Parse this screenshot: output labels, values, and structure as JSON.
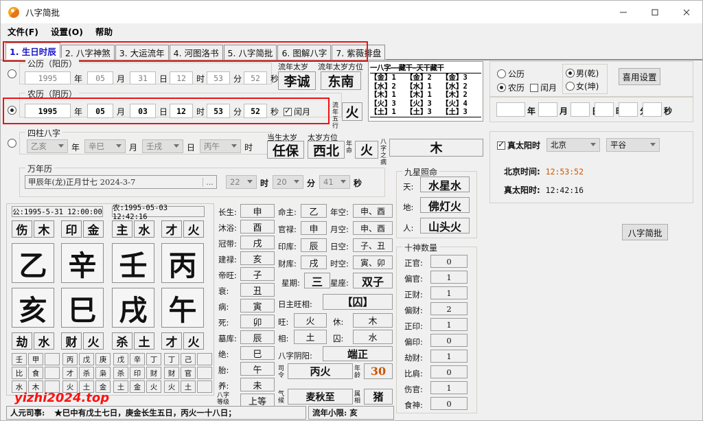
{
  "window": {
    "title": "八字简批",
    "minimize": "—",
    "maximize": "□",
    "close": "✕"
  },
  "menu": [
    {
      "label": "文件(F)"
    },
    {
      "label": "设置(O)"
    },
    {
      "label": "帮助"
    }
  ],
  "tabs": [
    {
      "label": "1. 生日时辰",
      "active": true
    },
    {
      "label": "2. 八字神煞",
      "active": false
    },
    {
      "label": "3. 大运流年",
      "active": false
    },
    {
      "label": "4. 河图洛书",
      "active": false
    },
    {
      "label": "5. 八字简批",
      "active": false
    },
    {
      "label": "6. 图解八字",
      "active": false
    },
    {
      "label": "7. 紫薇排盘",
      "active": false
    }
  ],
  "solar": {
    "caption": "公历（阳历）",
    "selected": false,
    "year": "1995",
    "month": "05",
    "day": "31",
    "hour": "12",
    "minute": "53",
    "second": "52",
    "unit_year": "年",
    "unit_month": "月",
    "unit_day": "日",
    "unit_hour": "时",
    "unit_minute": "分",
    "unit_second": "秒"
  },
  "lunar": {
    "caption": "农历（阴历）",
    "selected": true,
    "year": "1995",
    "month": "05",
    "day": "03",
    "hour": "12",
    "minute": "53",
    "second": "52",
    "unit_year": "年",
    "unit_month": "月",
    "unit_day": "日",
    "unit_hour": "时",
    "unit_minute": "分",
    "unit_second": "秒",
    "leap_label": "闰月",
    "leap_checked": true
  },
  "taisui": {
    "year_label": "流年太岁",
    "year_value": "李诚",
    "dir_label": "流年太岁方位",
    "dir_value": "东南",
    "wuxing_label": "流年五行",
    "wuxing_value": "火"
  },
  "pillars": {
    "caption": "四柱八字",
    "selected": false,
    "year": "乙亥",
    "month": "辛巳",
    "day": "壬戌",
    "hour": "丙午",
    "unit_year": "年",
    "unit_month": "月",
    "unit_day": "日",
    "unit_hour": "时"
  },
  "birth_taisui": {
    "label": "当生太岁",
    "value": "任保",
    "dir_label": "太岁方位",
    "dir_value": "西北",
    "nianming_label": "年命",
    "nianming_value": "火",
    "bingh_label": "八字之病",
    "bingh_value": "木"
  },
  "wannianli": {
    "caption": "万年历",
    "text": "甲辰年(龙)正月廿七  2024-3-7",
    "browse": "...",
    "hour": "22",
    "minute": "20",
    "second": "41",
    "unit_hour": "时",
    "unit_minute": "分",
    "unit_second": "秒"
  },
  "elements_table": {
    "header": "一八字——藏干—天干藏干",
    "rows": [
      {
        "name": "【金】",
        "bazi": "1",
        "canggan": "2",
        "tiangan": "3"
      },
      {
        "name": "【水】",
        "bazi": "2",
        "canggan": "1",
        "tiangan": "2"
      },
      {
        "name": "【木】",
        "bazi": "1",
        "canggan": "1",
        "tiangan": "2"
      },
      {
        "name": "【火】",
        "bazi": "3",
        "canggan": "3",
        "tiangan": "4"
      },
      {
        "name": "【土】",
        "bazi": "1",
        "canggan": "3",
        "tiangan": "3"
      }
    ]
  },
  "calendar_opts": {
    "solar_label": "公历",
    "solar_selected": false,
    "lunar_label": "农历",
    "lunar_selected": true,
    "leap_label": "闰月",
    "leap_checked": false,
    "male_label": "男(乾)",
    "male_selected": true,
    "female_label": "女(坤)",
    "female_selected": false,
    "settings_button": "喜用设置"
  },
  "blank_date": {
    "year": "",
    "month": "",
    "day": "",
    "hour": "",
    "minute": "",
    "second": "",
    "unit_year": "年",
    "unit_month": "月",
    "unit_day": "日",
    "unit_hour": "时",
    "unit_minute": "分",
    "unit_second": "秒"
  },
  "truesolar": {
    "check_label": "真太阳时",
    "checked": true,
    "province": "北京",
    "city": "平谷",
    "beijing_label": "北京时间:",
    "beijing_value": "12:53:52",
    "true_label": "真太阳时:",
    "true_value": "12:42:16",
    "analyze_button": "八字简批"
  },
  "chart": {
    "solar_header": "公:1995-5-31 12:00:00",
    "lunar_header": "农:1995-05-03 12:42:16",
    "top_gods": [
      {
        "god": "伤",
        "elem": "木"
      },
      {
        "god": "印",
        "elem": "金"
      },
      {
        "god": "主",
        "elem": "水"
      },
      {
        "god": "才",
        "elem": "火"
      }
    ],
    "stems": [
      "乙",
      "辛",
      "壬",
      "丙"
    ],
    "branches": [
      "亥",
      "巳",
      "戌",
      "午"
    ],
    "bottom_gods": [
      {
        "god": "劫",
        "elem": "水"
      },
      {
        "god": "财",
        "elem": "火"
      },
      {
        "god": "杀",
        "elem": "土"
      },
      {
        "god": "才",
        "elem": "火"
      }
    ],
    "hidden": [
      {
        "stems": [
          "壬",
          "甲",
          ""
        ],
        "gods": [
          "比",
          "食",
          ""
        ],
        "elems": [
          "水",
          "木",
          ""
        ]
      },
      {
        "stems": [
          "丙",
          "戊",
          "庚"
        ],
        "gods": [
          "才",
          "杀",
          "枭"
        ],
        "elems": [
          "火",
          "土",
          "金"
        ]
      },
      {
        "stems": [
          "戊",
          "辛",
          "丁"
        ],
        "gods": [
          "杀",
          "印",
          "财"
        ],
        "elems": [
          "土",
          "金",
          "火"
        ]
      },
      {
        "stems": [
          "丁",
          "己",
          ""
        ],
        "gods": [
          "财",
          "官",
          ""
        ],
        "elems": [
          "火",
          "土",
          ""
        ]
      }
    ]
  },
  "watermark": "yizhi2024.top",
  "stages": [
    {
      "label": "长生:",
      "value": "申"
    },
    {
      "label": "沐浴:",
      "value": "酉"
    },
    {
      "label": "冠带:",
      "value": "戌"
    },
    {
      "label": "建禄:",
      "value": "亥"
    },
    {
      "label": "帝旺:",
      "value": "子"
    },
    {
      "label": "衰:",
      "value": "丑"
    },
    {
      "label": "病:",
      "value": "寅"
    },
    {
      "label": "死:",
      "value": "卯"
    },
    {
      "label": "墓库:",
      "value": "辰"
    },
    {
      "label": "绝:",
      "value": "巳"
    },
    {
      "label": "胎:",
      "value": "午"
    },
    {
      "label": "养:",
      "value": "未"
    },
    {
      "label": "八字等级",
      "value": "上等"
    }
  ],
  "info_left": [
    {
      "label": "命主:",
      "value": "乙"
    },
    {
      "label": "官禄:",
      "value": "申"
    },
    {
      "label": "印库:",
      "value": "辰"
    },
    {
      "label": "财库:",
      "value": "戌"
    },
    {
      "label": "星期:",
      "value": "三"
    }
  ],
  "info_right": [
    {
      "label": "年空:",
      "value": "申、酉"
    },
    {
      "label": "月空:",
      "value": "申、酉"
    },
    {
      "label": "日空:",
      "value": "子、丑"
    },
    {
      "label": "时空:",
      "value": "寅、卯"
    },
    {
      "label": "星座:",
      "value": "双子"
    }
  ],
  "rizhu": {
    "label": "日主旺相:",
    "value": "【囚】",
    "wang_label": "旺:",
    "wang_value": "火",
    "xiu_label": "休:",
    "xiu_value": "木",
    "xiang_label": "相:",
    "xiang_value": "土",
    "qiu_label": "囚:",
    "qiu_value": "水",
    "yinyang_label": "八字阴阳:",
    "yinyang_value": "端正",
    "siling_label": "司令",
    "siling_value": "丙火",
    "age_label": "年龄",
    "age_value": "30",
    "qihou_label": "气候",
    "qihou_value": "麦秋至",
    "zodiac_label": "属相",
    "zodiac_value": "猪"
  },
  "jiuxing": {
    "caption": "九星照命",
    "rows": [
      {
        "label": "天:",
        "value": "水星水"
      },
      {
        "label": "地:",
        "value": "佛灯火"
      },
      {
        "label": "人:",
        "value": "山头火"
      }
    ]
  },
  "shishen": {
    "caption": "十神数量",
    "rows": [
      {
        "label": "正官:",
        "value": "0"
      },
      {
        "label": "偏官:",
        "value": "1"
      },
      {
        "label": "正财:",
        "value": "1"
      },
      {
        "label": "偏财:",
        "value": "2"
      },
      {
        "label": "正印:",
        "value": "1"
      },
      {
        "label": "偏印:",
        "value": "0"
      },
      {
        "label": "劫财:",
        "value": "1"
      },
      {
        "label": "比肩:",
        "value": "0"
      },
      {
        "label": "伤官:",
        "value": "1"
      },
      {
        "label": "食神:",
        "value": "0"
      }
    ]
  },
  "status": {
    "renyuan_label": "人元司事:",
    "renyuan_text": "★巳中有戊土七日，庚金长生五日，丙火一十八日；",
    "liunian_text": "流年小限: 亥"
  },
  "colors": {
    "accent": "#1414c8",
    "red": "#ee1111",
    "orange": "#cc5500",
    "bg": "#f0f0f0"
  }
}
